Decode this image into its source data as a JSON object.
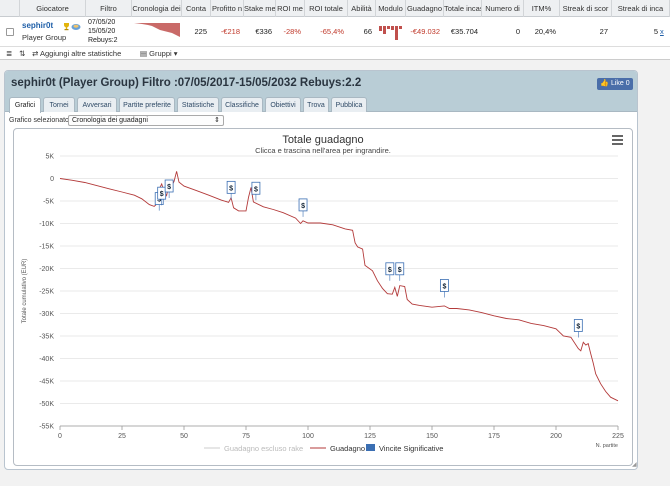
{
  "stats_table": {
    "headers": [
      "Giocatore",
      "Filtro",
      "Cronologia dei",
      "Conta",
      "Profitto n",
      "Stake me",
      "ROI me",
      "ROI totale",
      "Abilità",
      "Modulo",
      "Guadagno",
      "Totale incas",
      "Numero di",
      "ITM%",
      "Streak di scor",
      "Streak di inca"
    ],
    "row": {
      "player_name": "sephir0t",
      "player_group": "Player Group",
      "filter_lines": [
        "07/05/20",
        "15/05/20",
        "Rebuys:2"
      ],
      "values": [
        "225",
        "-€218",
        "€336",
        "-28%",
        "-65,4%",
        "66",
        "",
        "-€49.032",
        "€35.704",
        "0",
        "20,4%",
        "27",
        "5"
      ],
      "link": "x"
    }
  },
  "toolbar": {
    "add_stats": "Aggiungi altre statistiche",
    "groups": "Gruppi"
  },
  "panel": {
    "title": "sephir0t (Player Group) Filtro :07/05/2017-15/05/2032 Rebuys:2.2",
    "like_label": "Like 0",
    "tabs": [
      "Grafici",
      "Tornei",
      "Avversari",
      "Partite preferite",
      "Statistiche",
      "Classifiche",
      "Obiettivi",
      "Trova",
      "Pubblica"
    ],
    "selector_label": "Grafico selezionato",
    "selector_value": "Cronologia dei guadagni"
  },
  "chart_data": {
    "type": "line",
    "title": "Totale guadagno",
    "subtitle": "Clicca e trascina nell'area per ingrandire.",
    "ylabel": "Totale cumulativo (EUR)",
    "xlabel": "N. partite",
    "ylim": [
      -55000,
      5000
    ],
    "xlim": [
      0,
      225
    ],
    "yticks": [
      "5K",
      "0",
      "-5K",
      "-10K",
      "-15K",
      "-20K",
      "-25K",
      "-30K",
      "-35K",
      "-40K",
      "-45K",
      "-50K",
      "-55K"
    ],
    "ytick_values": [
      5000,
      0,
      -5000,
      -10000,
      -15000,
      -20000,
      -25000,
      -30000,
      -35000,
      -40000,
      -45000,
      -50000,
      -55000
    ],
    "xticks": [
      0,
      25,
      50,
      75,
      100,
      125,
      150,
      175,
      200,
      225
    ],
    "legend": [
      "Guadagno escluso rake",
      "Guadagno",
      "Vincite Significative"
    ],
    "series": [
      {
        "name": "Guadagno",
        "color": "#b33a3a",
        "points": [
          [
            0,
            0
          ],
          [
            5,
            -400
          ],
          [
            10,
            -900
          ],
          [
            15,
            -1600
          ],
          [
            20,
            -2300
          ],
          [
            25,
            -3000
          ],
          [
            30,
            -3700
          ],
          [
            33,
            -4500
          ],
          [
            36,
            -5800
          ],
          [
            38,
            -6200
          ],
          [
            39,
            -5700
          ],
          [
            40,
            -2300
          ],
          [
            41,
            -1200
          ],
          [
            42,
            -3000
          ],
          [
            43,
            -3800
          ],
          [
            44,
            -1100
          ],
          [
            45,
            -1800
          ],
          [
            46,
            -600
          ],
          [
            47,
            1600
          ],
          [
            48,
            -800
          ],
          [
            50,
            -1700
          ],
          [
            55,
            -2700
          ],
          [
            60,
            -3700
          ],
          [
            65,
            -4800
          ],
          [
            68,
            -5300
          ],
          [
            69,
            -4300
          ],
          [
            70,
            -6500
          ],
          [
            72,
            -7200
          ],
          [
            75,
            -7200
          ],
          [
            76,
            -4200
          ],
          [
            77,
            -2000
          ],
          [
            78,
            -5200
          ],
          [
            82,
            -6300
          ],
          [
            86,
            -6900
          ],
          [
            90,
            -7600
          ],
          [
            95,
            -8800
          ],
          [
            97,
            -10000
          ],
          [
            98,
            -9400
          ],
          [
            100,
            -9900
          ],
          [
            105,
            -9900
          ],
          [
            110,
            -10300
          ],
          [
            115,
            -11200
          ],
          [
            118,
            -11500
          ],
          [
            119,
            -14300
          ],
          [
            120,
            -15200
          ],
          [
            122,
            -15700
          ],
          [
            123,
            -19300
          ],
          [
            126,
            -20500
          ],
          [
            128,
            -22700
          ],
          [
            130,
            -24400
          ],
          [
            132,
            -25600
          ],
          [
            134,
            -25700
          ],
          [
            135,
            -24200
          ],
          [
            136,
            -26200
          ],
          [
            137,
            -23800
          ],
          [
            139,
            -24000
          ],
          [
            140,
            -26900
          ],
          [
            142,
            -27900
          ],
          [
            145,
            -28200
          ],
          [
            150,
            -28600
          ],
          [
            155,
            -28300
          ],
          [
            157,
            -28900
          ],
          [
            160,
            -28900
          ],
          [
            165,
            -29200
          ],
          [
            170,
            -29800
          ],
          [
            175,
            -30500
          ],
          [
            180,
            -31100
          ],
          [
            185,
            -31400
          ],
          [
            190,
            -32200
          ],
          [
            195,
            -32700
          ],
          [
            200,
            -33400
          ],
          [
            203,
            -35000
          ],
          [
            206,
            -35300
          ],
          [
            209,
            -37800
          ],
          [
            210,
            -38300
          ],
          [
            211,
            -36400
          ],
          [
            212,
            -37000
          ],
          [
            213,
            -36700
          ],
          [
            214,
            -38900
          ],
          [
            215,
            -41000
          ],
          [
            216,
            -43400
          ],
          [
            218,
            -45600
          ],
          [
            220,
            -47300
          ],
          [
            222,
            -48600
          ],
          [
            225,
            -49400
          ]
        ]
      }
    ],
    "significant_wins": [
      [
        40,
        -5800
      ],
      [
        41,
        -4600
      ],
      [
        44,
        -3000
      ],
      [
        79,
        -3500
      ],
      [
        69,
        -3300
      ],
      [
        98,
        -7200
      ],
      [
        133,
        -21400
      ],
      [
        137,
        -21400
      ],
      [
        155,
        -25100
      ],
      [
        209,
        -34000
      ]
    ]
  }
}
